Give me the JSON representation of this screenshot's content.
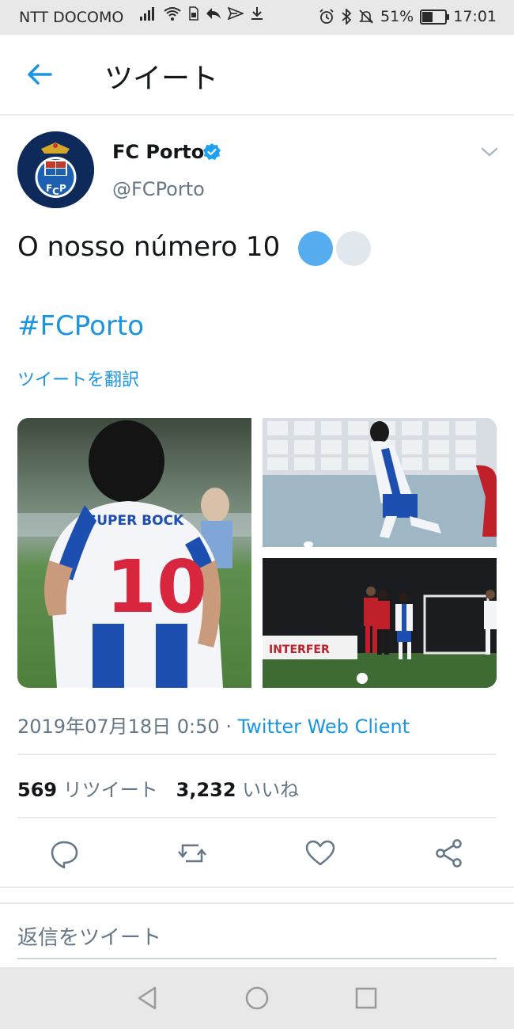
{
  "status_bar": {
    "carrier": "NTT DOCOMO",
    "battery_percent": "51%",
    "battery_level": 0.51,
    "time": "17:01",
    "icons": [
      "signal-icon",
      "wifi-icon",
      "sim-icon",
      "reply-notification-icon",
      "send-notification-icon",
      "download-icon",
      "alarm-icon",
      "bluetooth-icon",
      "mute-icon",
      "battery-icon"
    ]
  },
  "app_bar": {
    "back_icon": "arrow-left-icon",
    "title": "ツイート"
  },
  "tweet": {
    "author_name": "FC Porto",
    "author_handle": "@FCPorto",
    "verified": true,
    "text": "O nosso número 10",
    "hashtag": "#FCPorto",
    "translate_link": "ツイートを翻訳",
    "media": [
      {
        "logo_text": "SUPER BOCK",
        "shirt_number": "10"
      },
      {},
      {
        "board_text": "INTERFER"
      }
    ],
    "date": "2019年07月18日 0:50",
    "separator": " · ",
    "client": "Twitter Web Client",
    "retweet_count": "569",
    "retweet_label": "リツイート",
    "like_count": "3,232",
    "like_label": "いいね"
  },
  "actions": [
    "reply-icon",
    "retweet-icon",
    "like-icon",
    "share-icon"
  ],
  "reply_placeholder": "返信をツイート",
  "nav_bar": [
    "back-triangle-icon",
    "home-circle-icon",
    "recents-square-icon"
  ],
  "colors": {
    "accent": "#1b95e0",
    "secondary_text": "#657786",
    "primary_text": "#14171a",
    "avatar_bg": "#0e2a5a"
  }
}
